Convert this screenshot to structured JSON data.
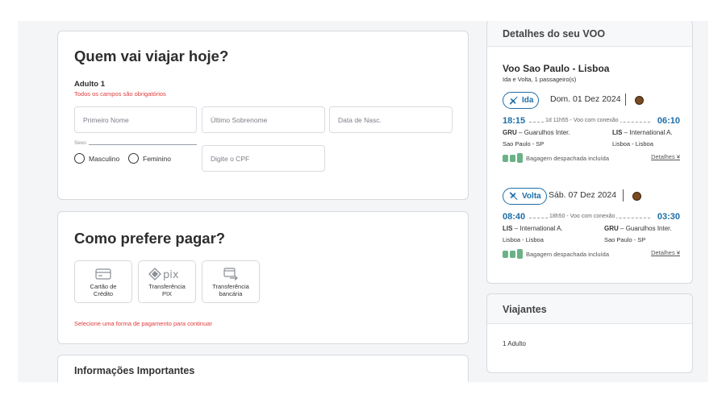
{
  "passengers": {
    "title": "Quem vai viajar hoje?",
    "adult_label": "Adulto 1",
    "required_note": "Todos os campos são obrigatórios",
    "first_name_placeholder": "Primeiro Nome",
    "last_name_placeholder": "Último Sobrenome",
    "birth_placeholder": "Data de Nasc.",
    "sex_label": "Sexo",
    "sex_options": [
      "Masculino",
      "Feminino"
    ],
    "cpf_placeholder": "Digite o CPF"
  },
  "payment": {
    "title": "Como prefere pagar?",
    "options": [
      {
        "label_1": "Cartão de",
        "label_2": "Crédito",
        "icon": "credit-card-icon"
      },
      {
        "label_1": "Transferência",
        "label_2": "PIX",
        "icon": "pix-icon"
      },
      {
        "label_1": "Transferência",
        "label_2": "bancária",
        "icon": "bank-transfer-icon"
      }
    ],
    "error": "Selecione uma forma de pagamento para continuar"
  },
  "important_info": {
    "title": "Informações Importantes"
  },
  "flight_details": {
    "title": "Detalhes do seu VOO",
    "route": "Voo Sao Paulo - Lisboa",
    "route_sub": "Ida e Volta, 1 passageiro(s)",
    "legs": [
      {
        "type": "Ida",
        "date": "Dom. 01 Dez 2024",
        "depart_time": "18:15",
        "arrive_time": "06:10",
        "duration": "1d 11h55 - Voo com conexão",
        "origin_code": "GRU",
        "origin_airport": "Guarulhos Inter.",
        "origin_city": "Sao Paulo - SP",
        "dest_code": "LIS",
        "dest_airport": "International A.",
        "dest_city": "Lisboa - Lisboa",
        "baggage": "Bagagem despachada incluída",
        "details": "Detalhes"
      },
      {
        "type": "Volta",
        "date": "Sáb. 07 Dez 2024",
        "depart_time": "08:40",
        "arrive_time": "03:30",
        "duration": "18h50 - Voo com conexão",
        "origin_code": "LIS",
        "origin_airport": "International A.",
        "origin_city": "Lisboa - Lisboa",
        "dest_code": "GRU",
        "dest_airport": "Guarulhos Inter.",
        "dest_city": "Sao Paulo - SP",
        "baggage": "Bagagem despachada incluída",
        "details": "Detalhes"
      }
    ]
  },
  "travelers": {
    "title": "Viajantes",
    "summary": "1 Adulto"
  },
  "colors": {
    "accent": "#1f6ea8",
    "error": "#e23b3b",
    "baggage": "#6ab187"
  }
}
